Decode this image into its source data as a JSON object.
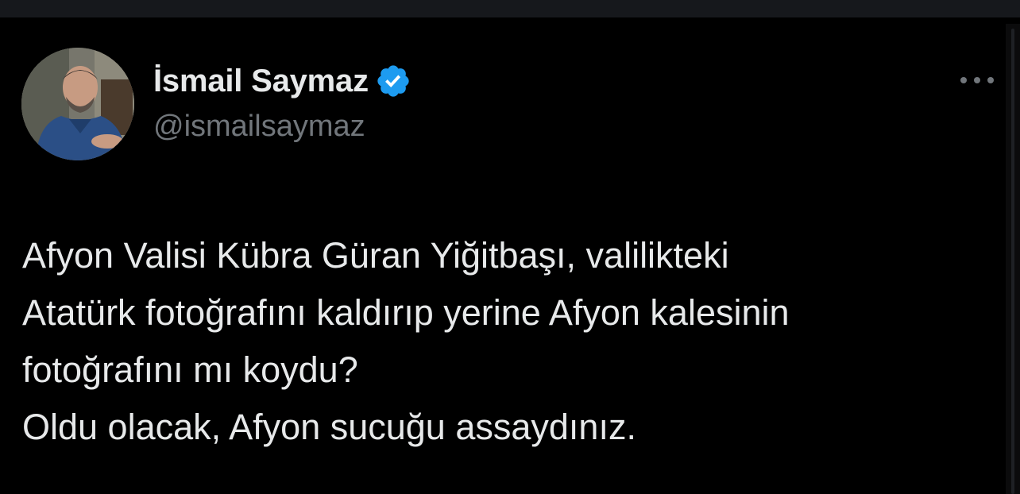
{
  "author": {
    "display_name": "İsmail Saymaz",
    "handle": "@ismailsaymaz",
    "verified": true,
    "avatar_icon": "profile-photo",
    "verified_icon": "verified-badge-icon",
    "verified_color": "#1d9bf0"
  },
  "actions": {
    "more_icon": "more-options-icon"
  },
  "tweet": {
    "lines": [
      "Afyon Valisi Kübra Güran Yiğitbaşı, valilikteki",
      "Atatürk fotoğrafını kaldırıp yerine Afyon kalesinin",
      "fotoğrafını mı koydu?",
      "Oldu olacak, Afyon sucuğu assaydınız."
    ]
  },
  "colors": {
    "background": "#000000",
    "text_primary": "#e7e9ea",
    "text_secondary": "#71767b"
  }
}
